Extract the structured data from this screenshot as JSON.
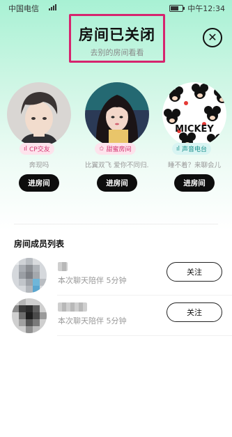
{
  "status_bar": {
    "carrier": "中国电信",
    "network": "4G",
    "time": "中午12:34"
  },
  "header": {
    "title": "房间已关闭",
    "subtitle": "去别的房间看看",
    "close_icon": "close-icon",
    "highlight_color": "#d6246e"
  },
  "rooms": [
    {
      "tag": "CP交友",
      "tag_icon": "sound-bars-icon",
      "tag_color": "#f06292",
      "tag_bg": "#fde3ec",
      "desc": "奔现吗",
      "button": "进房间"
    },
    {
      "tag": "甜蜜房间",
      "tag_icon": "star-icon",
      "tag_color": "#e0508a",
      "tag_bg": "#fde3ec",
      "desc": "比翼双飞 爱你不同归...",
      "button": "进房间"
    },
    {
      "tag": "声音电台",
      "tag_icon": "sound-bars-icon",
      "tag_color": "#1aa5a0",
      "tag_bg": "#d8f4f2",
      "desc": "睡不着？来聊会儿",
      "button": "进房间"
    }
  ],
  "members_section": {
    "title": "房间成员列表",
    "members": [
      {
        "info": "本次聊天陪伴 5分钟",
        "follow": "关注"
      },
      {
        "info": "本次聊天陪伴 5分钟",
        "follow": "关注"
      }
    ]
  }
}
